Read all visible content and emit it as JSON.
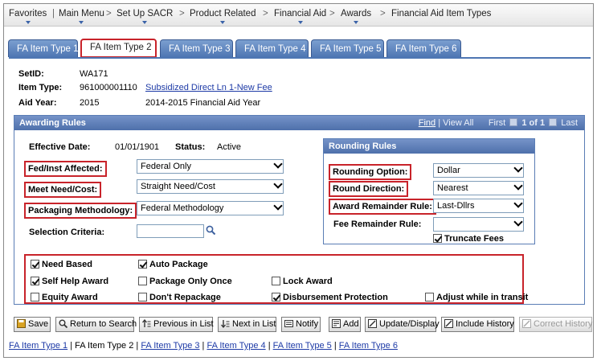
{
  "breadcrumb": {
    "items": [
      "Favorites",
      "Main Menu",
      "Set Up SACR",
      "Product Related",
      "Financial Aid",
      "Awards",
      "Financial Aid Item Types"
    ],
    "separator": ">"
  },
  "tabs": [
    "FA Item Type 1",
    "FA Item Type 2",
    "FA Item Type 3",
    "FA Item Type 4",
    "FA Item Type 5",
    "FA Item Type 6"
  ],
  "active_tab_index": 1,
  "header": {
    "setid_label": "SetID:",
    "setid_value": "WA171",
    "item_type_label": "Item Type:",
    "item_type_value": "961000001110",
    "item_type_desc": "Subsidized Direct Ln 1-New Fee",
    "aid_year_label": "Aid Year:",
    "aid_year_value": "2015",
    "aid_year_desc": "2014-2015 Financial Aid Year"
  },
  "awarding": {
    "title": "Awarding Rules",
    "nav_find": "Find",
    "nav_sep": "|",
    "nav_view_all": "View All",
    "nav_first": "First",
    "nav_count": "1 of 1",
    "nav_last": "Last",
    "effective_date_label": "Effective Date:",
    "effective_date_value": "01/01/1901",
    "status_label": "Status:",
    "status_value": "Active",
    "fed_inst_label": "Fed/Inst Affected:",
    "fed_inst_value": "Federal Only",
    "meet_need_label": "Meet Need/Cost:",
    "meet_need_value": "Straight Need/Cost",
    "packaging_label": "Packaging Methodology:",
    "packaging_value": "Federal Methodology",
    "selection_label": "Selection Criteria:",
    "selection_value": ""
  },
  "rounding": {
    "title": "Rounding Rules",
    "rounding_option_label": "Rounding Option:",
    "rounding_option_value": "Dollar",
    "round_direction_label": "Round Direction:",
    "round_direction_value": "Nearest",
    "award_remainder_label": "Award Remainder Rule:",
    "award_remainder_value": "Last-Dllrs",
    "fee_remainder_label": "Fee Remainder Rule:",
    "fee_remainder_value": "",
    "truncate_fees_label": "Truncate Fees",
    "truncate_fees_checked": true
  },
  "checkboxes": [
    {
      "label": "Need Based",
      "checked": true
    },
    {
      "label": "Auto Package",
      "checked": true
    },
    {
      "label": "Self Help Award",
      "checked": true
    },
    {
      "label": "Package Only Once",
      "checked": false
    },
    {
      "label": "Lock Award",
      "checked": false
    },
    {
      "label": "Equity Award",
      "checked": false
    },
    {
      "label": "Don't Repackage",
      "checked": false
    },
    {
      "label": "Disbursement Protection",
      "checked": true
    },
    {
      "label": "Adjust while in transit",
      "checked": false
    }
  ],
  "toolbar": {
    "save": "Save",
    "return": "Return to Search",
    "previous": "Previous in List",
    "next": "Next in List",
    "notify": "Notify",
    "add": "Add",
    "update": "Update/Display",
    "include_history": "Include History",
    "correct_history": "Correct History"
  },
  "bottom_links": [
    "FA Item Type 1",
    "FA Item Type 2",
    "FA Item Type 3",
    "FA Item Type 4",
    "FA Item Type 5",
    "FA Item Type 6"
  ],
  "bottom_sep": "|",
  "colors": {
    "accent": "#4e76b3",
    "highlight": "#c8232a",
    "link": "#1d3aa6"
  }
}
